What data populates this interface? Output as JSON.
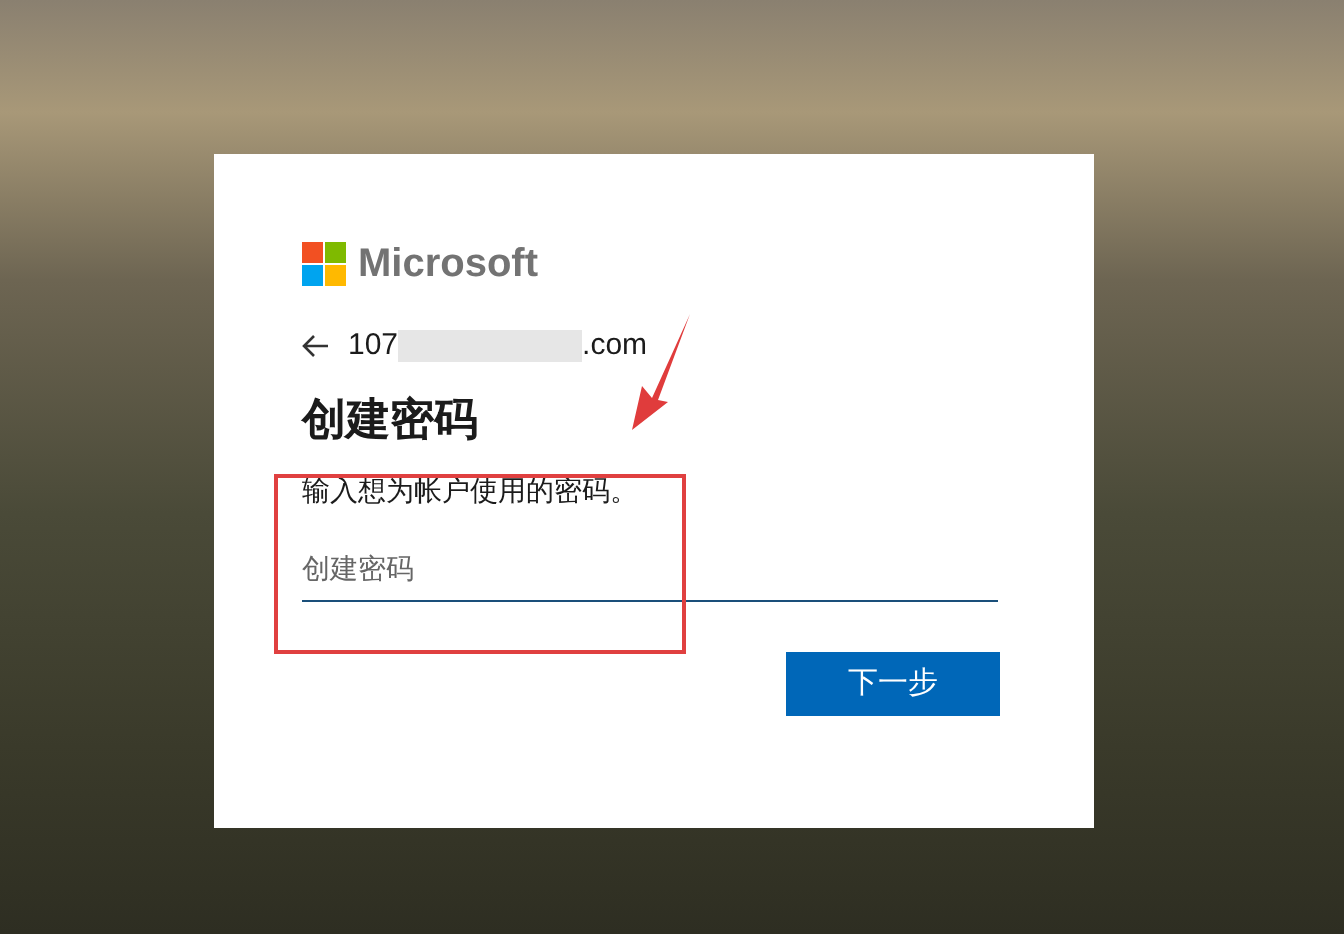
{
  "brand": {
    "name": "Microsoft"
  },
  "account": {
    "email_start": "107",
    "email_end": ".com"
  },
  "title": "创建密码",
  "description": "输入想为帐户使用的密码。",
  "password_field": {
    "placeholder": "创建密码"
  },
  "next_button": {
    "label": "下一步"
  }
}
